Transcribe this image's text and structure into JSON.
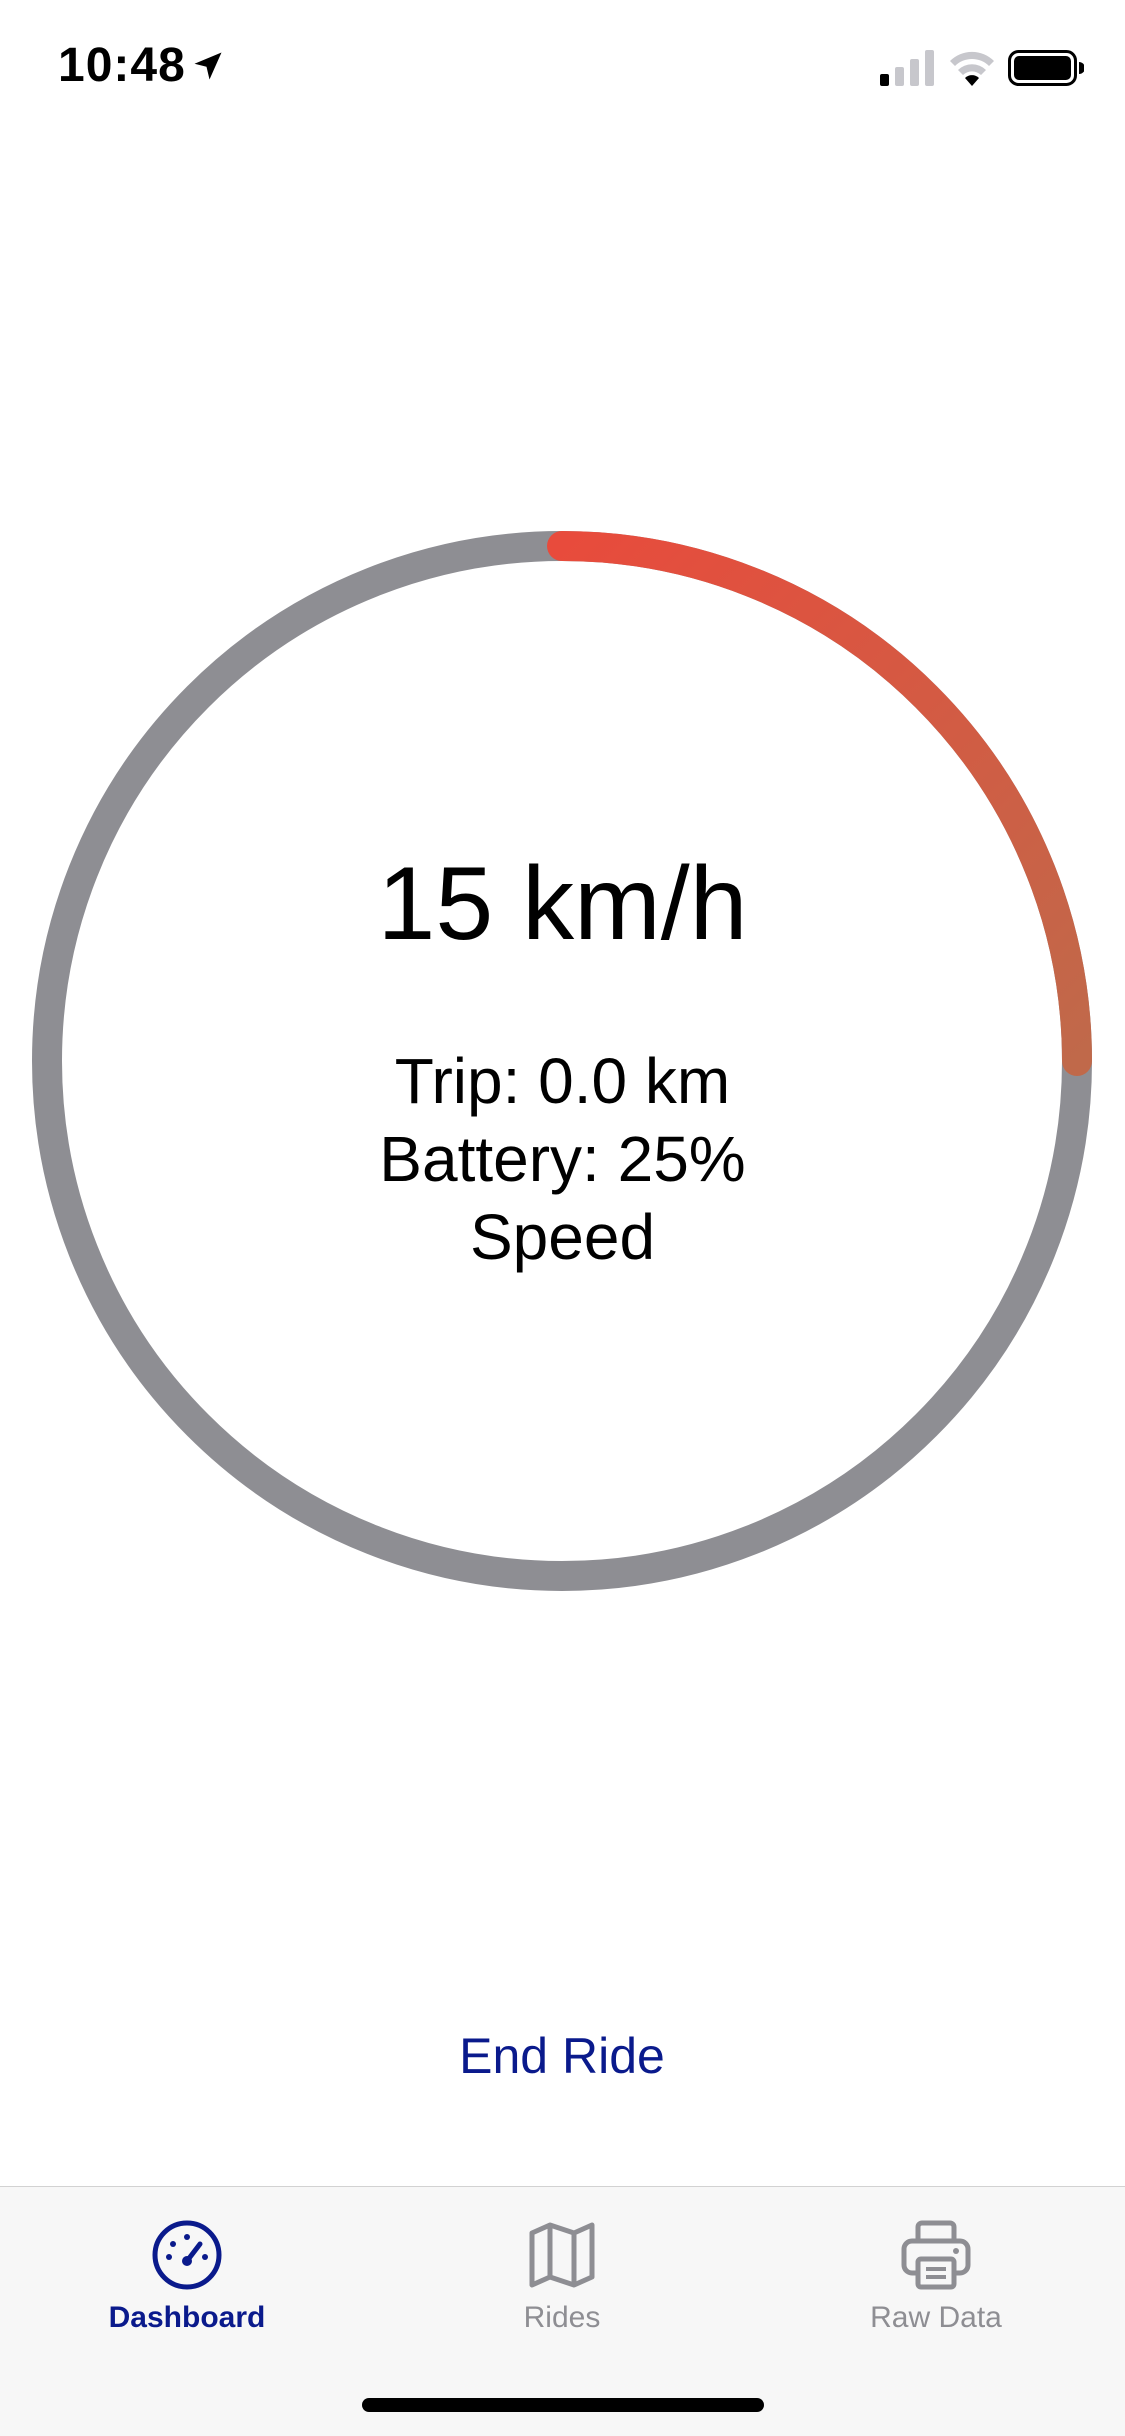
{
  "status_bar": {
    "time": "10:48",
    "icons": [
      "location-arrow-icon",
      "cellular-signal-icon",
      "wifi-icon",
      "battery-icon"
    ]
  },
  "gauge": {
    "speed": "15 km/h",
    "trip": "Trip: 0.0 km",
    "battery": "Battery: 25%",
    "mode": "Speed",
    "progress_fraction": 0.25,
    "track_color": "#8e8e93",
    "fill_color_start": "#e84b3c",
    "fill_color_end": "#c0694a"
  },
  "actions": {
    "end_ride": "End Ride"
  },
  "tab_bar": {
    "tabs": [
      {
        "label": "Dashboard",
        "icon": "speedometer-icon",
        "active": true
      },
      {
        "label": "Rides",
        "icon": "map-icon",
        "active": false
      },
      {
        "label": "Raw Data",
        "icon": "printer-icon",
        "active": false
      }
    ],
    "active_color": "#0a1a8c",
    "inactive_color": "#8e8e93"
  }
}
